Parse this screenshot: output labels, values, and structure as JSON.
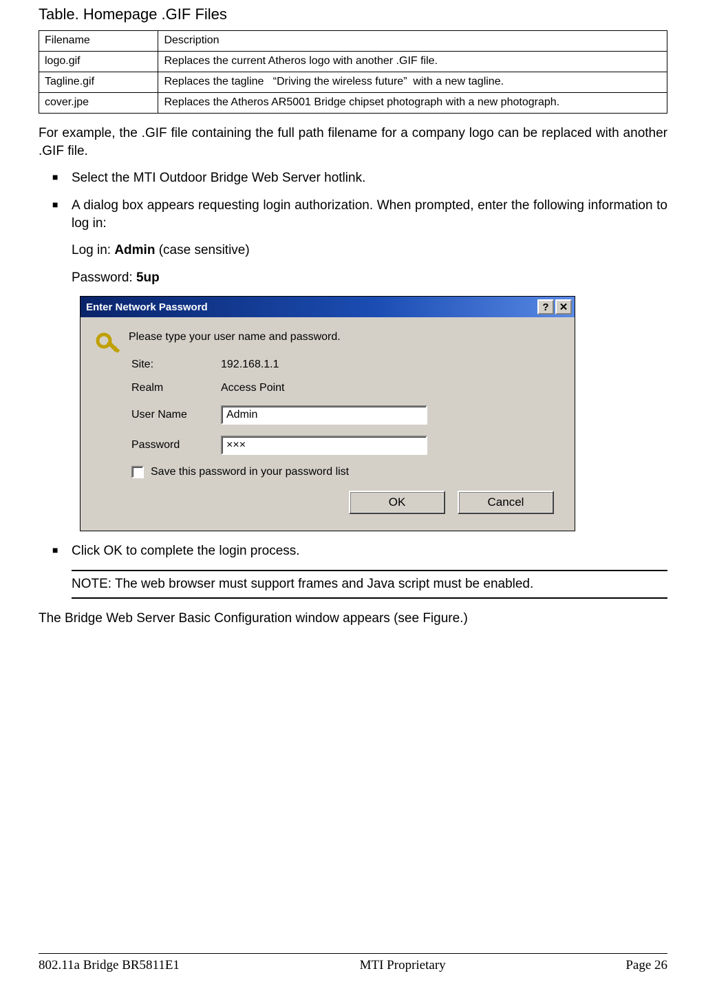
{
  "table": {
    "title": "Table. Homepage .GIF Files",
    "headers": [
      "Filename",
      "Description"
    ],
    "rows": [
      [
        "logo.gif",
        "Replaces the current Atheros logo with another .GIF file."
      ],
      [
        "Tagline.gif",
        "Replaces the tagline   “Driving the wireless future”  with a new tagline."
      ],
      [
        "cover.jpe",
        "Replaces the Atheros AR5001 Bridge chipset photograph with a new photograph."
      ]
    ]
  },
  "para_intro": "For example, the .GIF file containing the full path filename for a company logo can be replaced with another .GIF file.",
  "bullets": {
    "b1": "Select the MTI Outdoor Bridge Web Server hotlink.",
    "b2": "A dialog box appears requesting login authorization. When prompted, enter the following information to log in:"
  },
  "login_line": {
    "prefix": "Log in: ",
    "value": "Admin",
    "suffix": " (case sensitive)"
  },
  "password_line": {
    "prefix": "Password: ",
    "value": "5up"
  },
  "dialog": {
    "title": "Enter Network Password",
    "help_btn": "?",
    "close_btn": "✕",
    "message": "Please type your user name and password.",
    "site_label": "Site:",
    "site_value": "192.168.1.1",
    "realm_label": "Realm",
    "realm_value": "Access Point",
    "user_label": "User Name",
    "user_value": "Admin",
    "pass_label": "Password",
    "pass_value": "×××",
    "save_label": "Save this password in your password list",
    "ok": "OK",
    "cancel": "Cancel"
  },
  "bullet3": "Click OK to complete the login process.",
  "note": "NOTE: The web browser must support frames and Java script must be enabled.",
  "para_outro": "The Bridge Web Server Basic Configuration window appears (see Figure.)",
  "footer": {
    "left": "802.11a Bridge BR5811E1",
    "center": "MTI Proprietary",
    "right": "Page 26"
  }
}
